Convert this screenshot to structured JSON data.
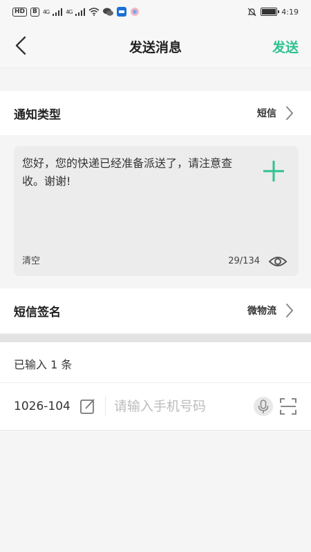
{
  "status_bar": {
    "hd_label": "HD",
    "sim_label": "B",
    "network_1": "4G",
    "network_2": "4G",
    "time": "4:19",
    "icons": [
      "signal-icon",
      "wifi-icon",
      "wechat-icon",
      "app-icon",
      "mute-icon",
      "battery-icon"
    ],
    "battery_level": 0.9
  },
  "nav": {
    "title": "发送消息",
    "send_label": "发送"
  },
  "notify_type": {
    "label": "通知类型",
    "value": "短信"
  },
  "message": {
    "text": "您好，您的快递已经准备派送了，请注意查收。谢谢!",
    "clear_label": "清空",
    "count": "29/134"
  },
  "signature": {
    "label": "短信签名",
    "value": "微物流"
  },
  "entered": {
    "text": "已输入 1 条"
  },
  "phone": {
    "code": "1026-104",
    "placeholder": "请输入手机号码",
    "value": ""
  },
  "colors": {
    "accent": "#2ec28f",
    "background": "#f5f5f5"
  }
}
